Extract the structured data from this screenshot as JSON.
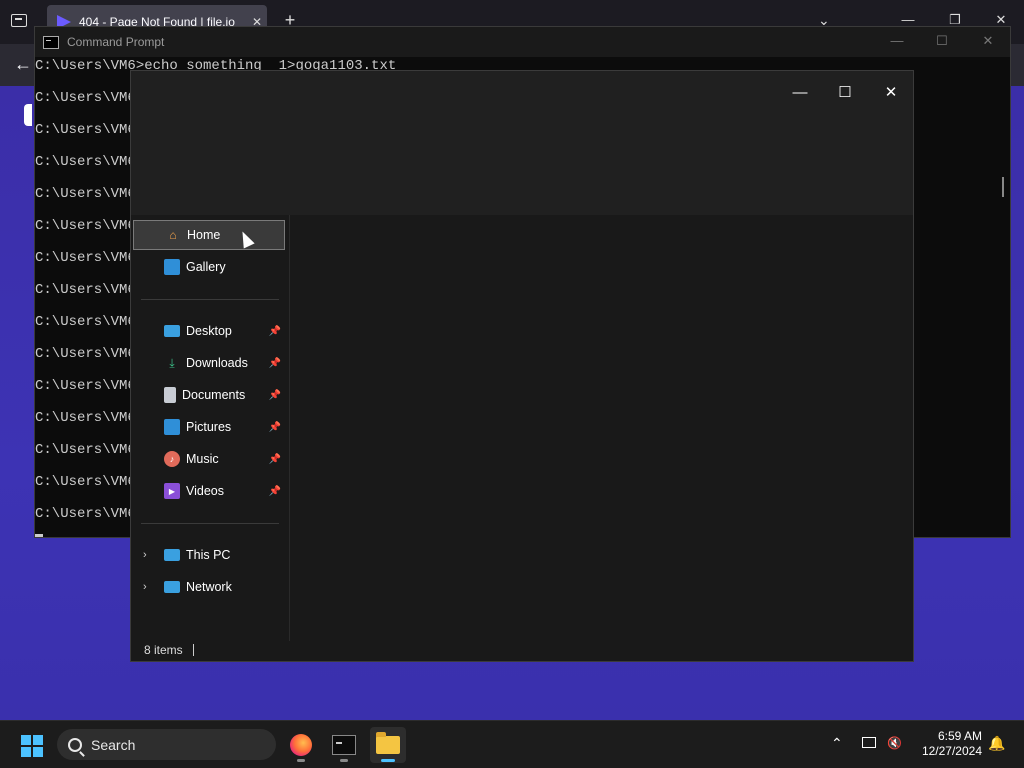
{
  "browser": {
    "tab_title": "404 - Page Not Found | file.io",
    "tab_close": "✕",
    "new_tab": "+",
    "chevron": "⌄",
    "minimize": "—",
    "restore": "❐",
    "close": "✕",
    "back": "←"
  },
  "cmd": {
    "title": "Command Prompt",
    "minimize": "—",
    "maximize": "☐",
    "close": "✕",
    "lines": [
      "C:\\Users\\VM6>echo something  1>goga1103.txt",
      "C:\\Users\\VM6",
      "C:\\Users\\VM6",
      "C:\\Users\\VM6",
      "C:\\Users\\VM6",
      "C:\\Users\\VM6",
      "C:\\Users\\VM6",
      "C:\\Users\\VM6",
      "C:\\Users\\VM6",
      "C:\\Users\\VM6",
      "C:\\Users\\VM6",
      "C:\\Users\\VM6",
      "C:\\Users\\VM6",
      "C:\\Users\\VM6",
      "C:\\Users\\VM6"
    ]
  },
  "explorer": {
    "minimize": "—",
    "maximize": "☐",
    "close": "✕",
    "nav": {
      "home": "Home",
      "gallery": "Gallery",
      "desktop": "Desktop",
      "downloads": "Downloads",
      "documents": "Documents",
      "pictures": "Pictures",
      "music": "Music",
      "videos": "Videos",
      "this_pc": "This PC",
      "network": "Network"
    },
    "pin": "📌",
    "expand": "›",
    "status_count": "8 items"
  },
  "taskbar": {
    "search": "Search",
    "time": "6:59 AM",
    "date": "12/27/2024",
    "tray_chevron": "⌃",
    "bell": "🔔",
    "volume": "🔇"
  },
  "colors": {
    "accent": "#4cc2ff",
    "desktop_bg": "#3a2fa3",
    "explorer_bg": "#191919"
  }
}
